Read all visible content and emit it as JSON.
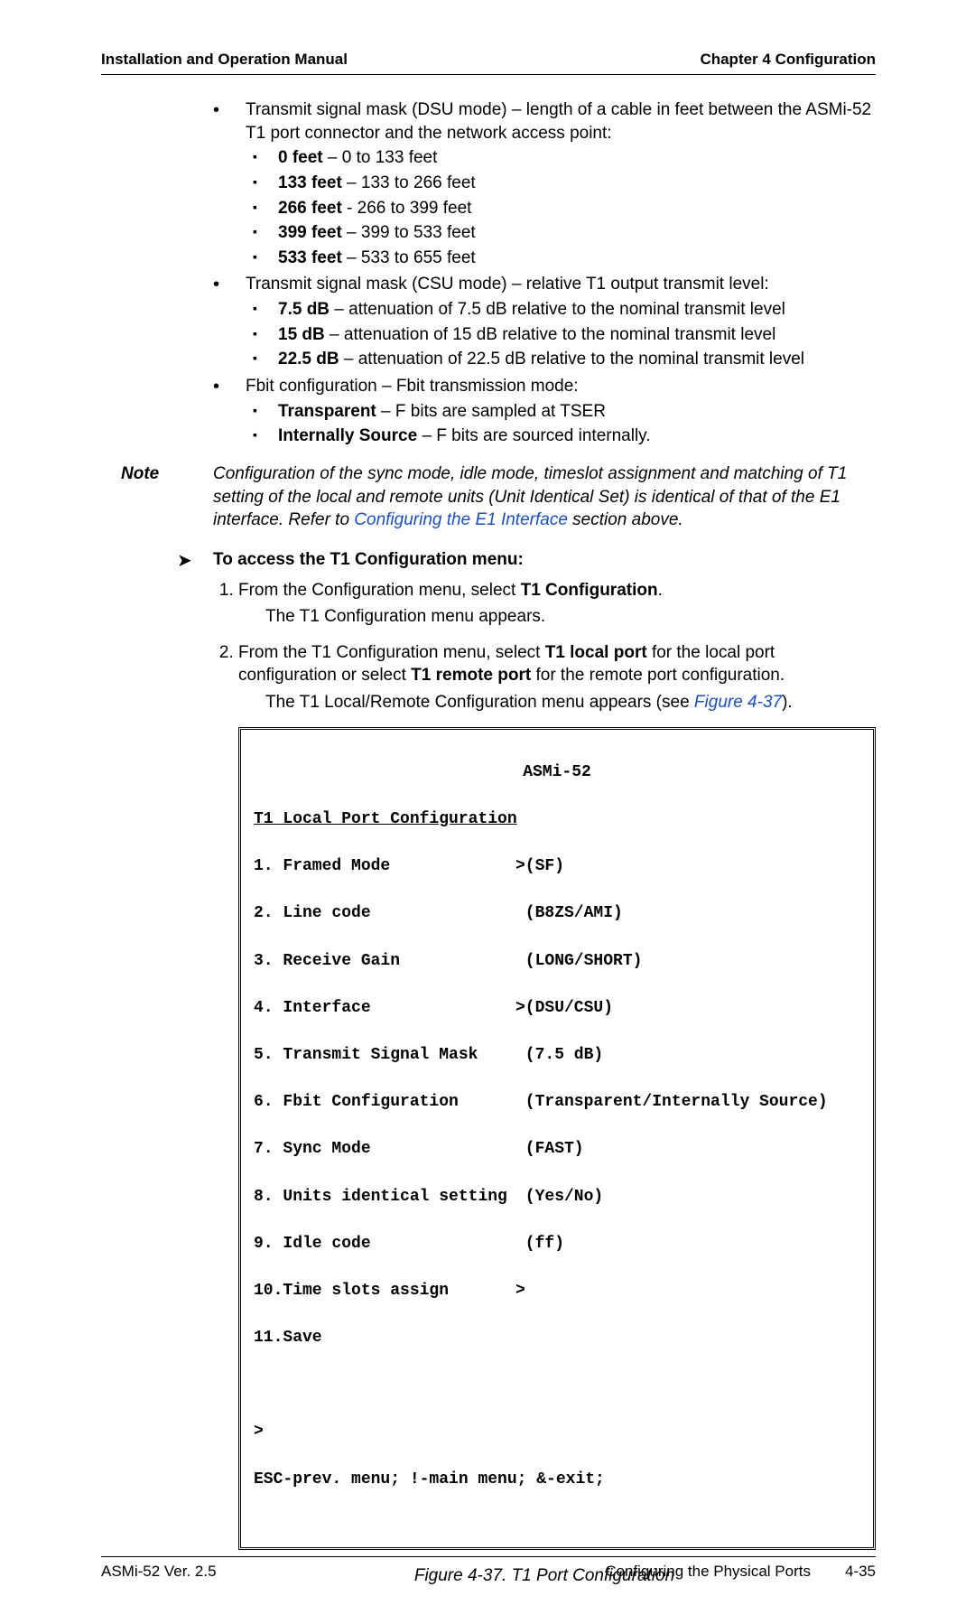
{
  "header": {
    "left": "Installation and Operation Manual",
    "right": "Chapter 4  Configuration"
  },
  "dsu": {
    "intro": "Transmit signal mask (DSU mode) – length of a cable in feet between the ASMi-52 T1 port connector and the network access point:",
    "items": [
      {
        "b": "0 feet",
        "t": " – 0 to 133 feet"
      },
      {
        "b": "133 feet",
        "t": " – 133 to 266 feet"
      },
      {
        "b": "266 feet",
        "t": " - 266 to 399 feet"
      },
      {
        "b": "399 feet",
        "t": " – 399 to 533 feet"
      },
      {
        "b": "533 feet",
        "t": " – 533 to 655 feet"
      }
    ]
  },
  "csu": {
    "intro": "Transmit signal mask (CSU mode) – relative T1 output transmit level:",
    "items": [
      {
        "b": "7.5 dB",
        "t": " – attenuation of 7.5 dB relative to the nominal transmit level"
      },
      {
        "b": "15 dB",
        "t": " – attenuation of 15 dB relative to the nominal transmit level"
      },
      {
        "b": "22.5 dB",
        "t": " – attenuation of 22.5 dB relative to the nominal transmit level"
      }
    ]
  },
  "fbit": {
    "intro": "Fbit configuration – Fbit transmission mode:",
    "items": [
      {
        "b": "Transparent",
        "t": " – F bits are sampled at TSER"
      },
      {
        "b": "Internally Source",
        "t": " – F bits are sourced internally."
      }
    ]
  },
  "note": {
    "label": "Note",
    "pre": "Configuration of the sync mode, idle mode, timeslot assignment and matching of T1 setting of the local and remote units (Unit Identical Set) is identical of that of the E1 interface. Refer to ",
    "link": "Configuring the E1 Interface",
    "post": " section above."
  },
  "proc": {
    "arrow": "➤",
    "head": "To access the T1 Configuration menu:",
    "step1_pre": "From the Configuration menu, select ",
    "step1_bold": "T1 Configuration",
    "step1_post": ".",
    "step1_sub": "The T1 Configuration menu appears.",
    "step2_pre": "From the T1 Configuration menu, select ",
    "step2_b1": "T1 local port",
    "step2_mid": " for the local port configuration or select ",
    "step2_b2": "T1 remote port",
    "step2_post": " for the remote port configuration.",
    "step2_sub_pre": "The T1 Local/Remote Configuration menu appears (see ",
    "step2_sub_link": "Figure 4-37",
    "step2_sub_post": ")."
  },
  "terminal": {
    "title": "ASMi-52",
    "heading": "T1 Local Port Configuration",
    "rows": [
      {
        "c1": "1. Framed Mode",
        "c2": ">(SF)"
      },
      {
        "c1": "2. Line code",
        "c2": " (B8ZS/AMI)"
      },
      {
        "c1": "3. Receive Gain",
        "c2": " (LONG/SHORT)"
      },
      {
        "c1": "4. Interface",
        "c2": ">(DSU/CSU)"
      },
      {
        "c1": "5. Transmit Signal Mask",
        "c2": " (7.5 dB)"
      },
      {
        "c1": "6. Fbit Configuration",
        "c2": " (Transparent/Internally Source)"
      },
      {
        "c1": "7. Sync Mode",
        "c2": " (FAST)"
      },
      {
        "c1": "8. Units identical setting",
        "c2": " (Yes/No)"
      },
      {
        "c1": "9. Idle code",
        "c2": " (ff)"
      },
      {
        "c1": "10.Time slots assign",
        "c2": ">"
      },
      {
        "c1": "11.Save",
        "c2": ""
      }
    ],
    "prompt": ">",
    "footer": "ESC-prev. menu; !-main menu; &-exit;"
  },
  "figcap": "Figure 4-37.  T1 Port Configuration",
  "footer": {
    "left": "ASMi-52 Ver. 2.5",
    "right_text": "Configuring the Physical Ports",
    "right_page": "4-35"
  }
}
